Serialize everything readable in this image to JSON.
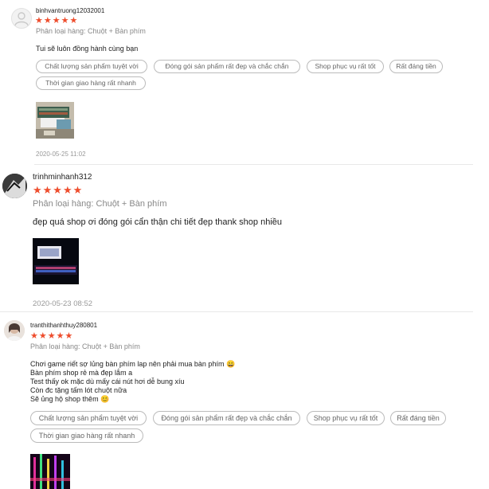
{
  "reviews": [
    {
      "username": "binhvantruong12032001",
      "stars": "★★★★★",
      "variant": "Phân loại hàng: Chuột + Bàn phím",
      "comment": [
        "Tui sẽ luôn đồng hành cùng bạn"
      ],
      "tags": [
        "Chất lượng sản phẩm tuyệt vời",
        "Đóng gói sản phẩm rất đẹp và chắc chắn",
        "Shop phục vụ rất tốt",
        "Rất đáng tiền",
        "Thời gian giao hàng rất nhanh"
      ],
      "time": "2020-05-25 11:02"
    },
    {
      "username": "trinhminhanh312",
      "stars": "★★★★★",
      "variant": "Phân loại hàng: Chuột + Bàn phím",
      "comment": [
        "đẹp quá shop ơi đóng gói cẩn thận chi tiết đẹp thank shop nhiều"
      ],
      "time": "2020-05-23 08:52"
    },
    {
      "username": "tranthithanhthuy280801",
      "stars": "★★★★★",
      "variant": "Phân loại hàng: Chuột + Bàn phím",
      "comment": [
        "Chơi game riết sợ lủng bàn phím lap nên phải mua bàn phím 😄",
        "Bàn phím shop rẻ mà đẹp lắm a",
        "Test thấy ok mặc dù mấy cái nút hơi dễ bung xíu",
        "Còn đc tặng tấm lót chuột nữa",
        "Sẽ ủng hộ shop thêm 😊"
      ],
      "tags": [
        "Chất lượng sản phẩm tuyệt vời",
        "Đóng gói sản phẩm rất đẹp và chắc chắn",
        "Shop phục vụ rất tốt",
        "Rất đáng tiền",
        "Thời gian giao hàng rất nhanh"
      ]
    }
  ],
  "colors": {
    "star": "#ee4d2d",
    "tag_border": "#bbbbbb",
    "muted": "#888888"
  },
  "icons": {
    "default_avatar": "person-outline-icon"
  }
}
